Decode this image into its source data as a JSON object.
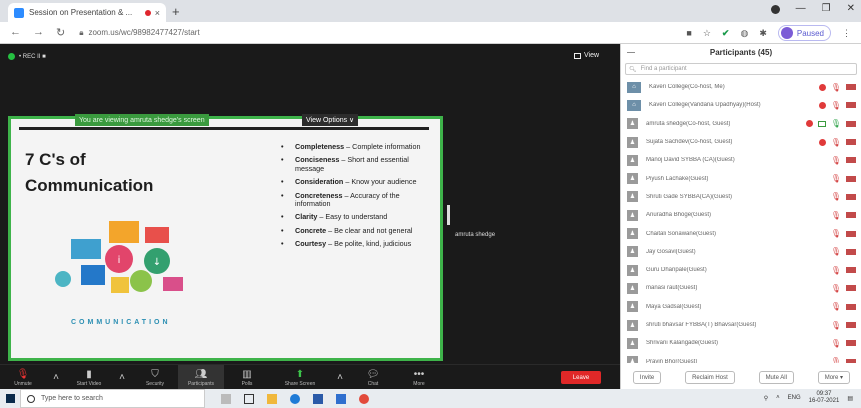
{
  "browser": {
    "tab_title": "Session on Presentation & ...",
    "tab_close": "×",
    "new_tab": "+",
    "url": "zoom.us/wc/98982477427/start",
    "paused_label": "Paused"
  },
  "meeting": {
    "rec_label": "• REC  II  ■",
    "view_label": "View",
    "share_notice": "You are viewing amruta shedge's screen",
    "view_options": "View Options ∨",
    "presenter_name": "amruta shedge"
  },
  "slide": {
    "title_line1": "7 C's of",
    "title_line2": "Communication",
    "art_word": "COMMUNICATION",
    "bullets": [
      {
        "key": "Completeness",
        "rest": " – Complete information"
      },
      {
        "key": "Conciseness",
        "rest": " – Short and essential message"
      },
      {
        "key": "Consideration",
        "rest": " – Know your audience"
      },
      {
        "key": "Concreteness",
        "rest": " – Accuracy of the information"
      },
      {
        "key": "Clarity",
        "rest": " – Easy to understand"
      },
      {
        "key": "Concrete",
        "rest": " – Be clear and not general"
      },
      {
        "key": "Courtesy",
        "rest": " – Be polite, kind, judicious"
      }
    ]
  },
  "toolbar": {
    "unmute": "Unmute",
    "start_video": "Start Video",
    "security": "Security",
    "participants": "Participants",
    "participants_count": "45",
    "polls": "Polls",
    "share_screen": "Share Screen",
    "chat": "Chat",
    "more": "More",
    "leave": "Leave"
  },
  "participants_panel": {
    "title": "Participants (45)",
    "search_placeholder": "Find a participant",
    "rows": [
      {
        "name": "Kaveri College(Co-host, Me)",
        "cohost": true,
        "rec": true
      },
      {
        "name": "Kaveri College(Vandana Upadhyay)(Host)",
        "cohost": true,
        "rec": true
      },
      {
        "name": "amruta shedge(Co-host, Guest)",
        "cohost": false,
        "rec": true,
        "sharing": true
      },
      {
        "name": "Sujata Sachdev(Co-host, Guest)",
        "cohost": false,
        "rec": true
      },
      {
        "name": "Manoj David SYBBA (CA)(Guest)",
        "cohost": false
      },
      {
        "name": "Piyush Lachake(Guest)",
        "cohost": false
      },
      {
        "name": "Shruti Gade SYBBA(CA)(Guest)",
        "cohost": false
      },
      {
        "name": "Anuradha Bhoge(Guest)",
        "cohost": false
      },
      {
        "name": "Chaitali Sonawane(Guest)",
        "cohost": false
      },
      {
        "name": "Jay Gosavi(Guest)",
        "cohost": false
      },
      {
        "name": "Guru Dhanpale(Guest)",
        "cohost": false
      },
      {
        "name": "manasi raut(Guest)",
        "cohost": false
      },
      {
        "name": "Maya Gadsal(Guest)",
        "cohost": false
      },
      {
        "name": "shruti bhavsar FYBBA(T)  Bhavsar(Guest)",
        "cohost": false
      },
      {
        "name": "Shrivani Kalangade(Guest)",
        "cohost": false
      },
      {
        "name": "Pravin Bhor(Guest)",
        "cohost": false
      }
    ],
    "footer": {
      "invite": "Invite",
      "reclaim_host": "Reclaim Host",
      "mute_all": "Mute All",
      "more": "More ▾"
    }
  },
  "taskbar": {
    "search_placeholder": "Type here to search",
    "lang": "ENG",
    "time": "09:37",
    "date": "16-07-2021"
  }
}
